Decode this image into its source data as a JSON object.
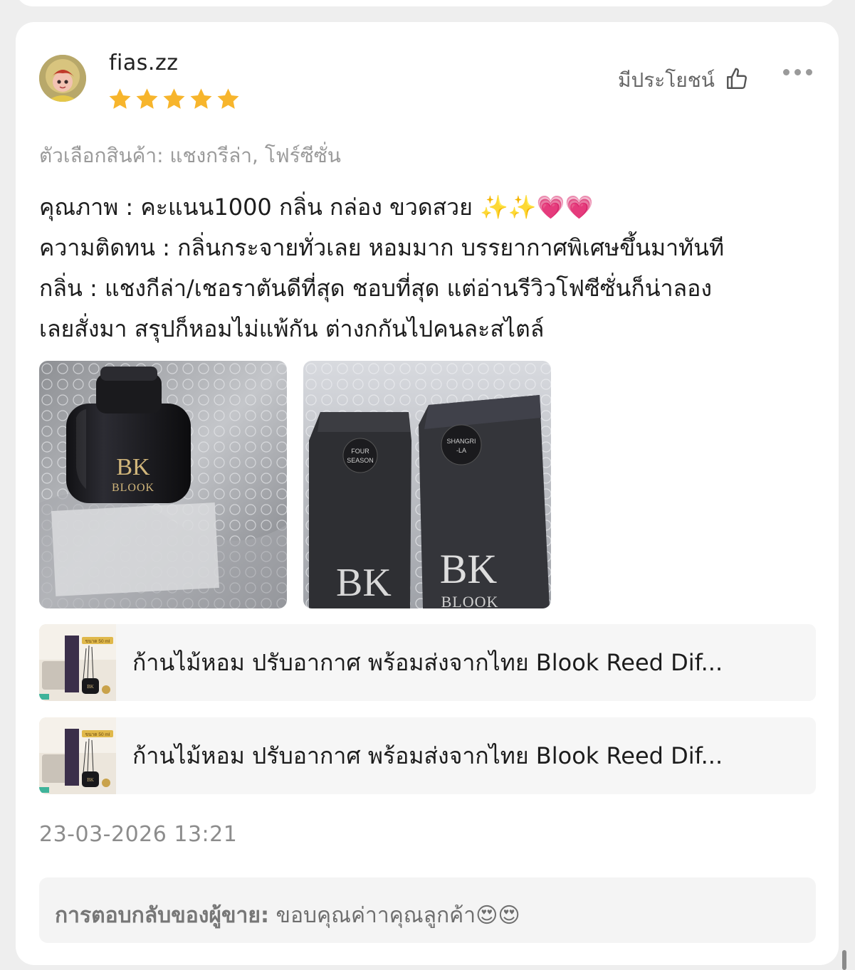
{
  "review": {
    "username": "fias.zz",
    "rating": 5,
    "rating_max": 5,
    "helpful_label": "มีประโยชน์",
    "variant": "ตัวเลือกสินค้า: แชงกรีล่า, โฟร์ซีซั่น",
    "body_lines": [
      "คุณภาพ : คะแนน1000 กลิ่น กล่อง ขวดสวย ✨✨💗💗",
      "ความติดทน : กลิ่นกระจายทั่วเลย หอมมาก บรรยากาศพิเศษขึ้นมาทันที",
      "กลิ่น : แชงกีล่า/เชอราตันดีที่สุด ชอบที่สุด แต่อ่านรีวิวโฟซีซั่นก็น่าลอง",
      "เลยสั่งมา สรุปก็หอมไม่แพ้กัน ต่างกกันไปคนละสไตล์"
    ],
    "photos": [
      {
        "brand_mark": "BK",
        "brand_name": "BLOOK"
      },
      {
        "brand_mark": "BK",
        "brand_name": "BLOOK",
        "label_left": "FOUR SEASON",
        "label_right": "SHANGRI-LA"
      }
    ],
    "products": [
      {
        "title": "ก้านไม้หอม ปรับอากาศ พร้อมส่งจากไทย Blook Reed Dif...",
        "thumb_badge": "ขนาด 50 ml",
        "brand_mark": "BK"
      },
      {
        "title": "ก้านไม้หอม ปรับอากาศ พร้อมส่งจากไทย Blook Reed Dif...",
        "thumb_badge": "ขนาด 50 ml",
        "brand_mark": "BK"
      }
    ],
    "timestamp": "23-03-2026 13:21",
    "seller_reply": {
      "label": "การตอบกลับของผู้ขาย:",
      "text": " ขอบคุณค่าาคุณลูกค้า😍😍"
    }
  },
  "colors": {
    "star": "#f7b52c",
    "background": "#eeeeee",
    "card": "#ffffff"
  },
  "icons": [
    "thumbs-up-icon",
    "more-options-icon",
    "star-icon",
    "avatar-icon"
  ]
}
